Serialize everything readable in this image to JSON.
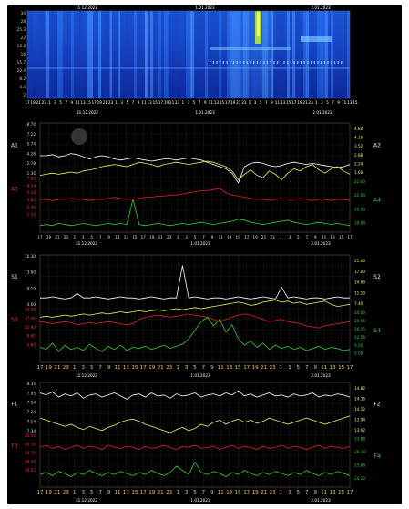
{
  "chart_data": [
    {
      "id": "spectrogram",
      "type": "heatmap",
      "top_labels": [
        "31.12.2022",
        "1.01.2023",
        "2.01.2023"
      ],
      "date_labels": [
        "31.12.2022",
        "1.01.2023",
        "2.01.2023"
      ],
      "y_ticks": [
        "34",
        "28",
        "25.3",
        "22",
        "18.8",
        "16",
        "15.7",
        "10.4",
        "8.2",
        "4.4",
        "2"
      ],
      "colors": {
        "low": "#0b1f8f",
        "mid": "#1f5fe0",
        "high": "#b8f23a",
        "peak": "#f0ff60"
      }
    },
    {
      "id": "panel-A",
      "type": "line",
      "x_ticks": [
        "17",
        "19",
        "21",
        "23",
        "1",
        "3",
        "5",
        "7",
        "9",
        "11",
        "13",
        "15",
        "17",
        "19",
        "21",
        "23",
        "1",
        "3",
        "5",
        "7",
        "9",
        "11",
        "13",
        "15",
        "17",
        "19",
        "21",
        "23",
        "1",
        "3",
        "5",
        "7",
        "9",
        "11",
        "13",
        "15",
        "17"
      ],
      "date_labels": [
        "31.12.2022",
        "1.01.2023",
        "2.01.2023"
      ],
      "left_axis_labels": [
        "A1",
        "A3"
      ],
      "right_axis_labels": [
        "A2",
        "A4"
      ],
      "left_ticks_upper": [
        "8.70",
        "7.22",
        "5.74",
        "4.26",
        "2.78",
        "1.30"
      ],
      "left_ticks_lower": [
        "7.90",
        "6.54",
        "5.18",
        "3.82",
        "2.46",
        "1.10"
      ],
      "right_ticks_upper": [
        "4.80",
        "4.16",
        "3.52",
        "2.88",
        "2.24",
        "1.60"
      ],
      "right_ticks_lower": [
        "22.00",
        "21.00",
        "20.00",
        "19.00"
      ],
      "series": [
        {
          "color": "#ffffff",
          "values": [
            0.3,
            0.3,
            0.29,
            0.31,
            0.3,
            0.28,
            0.29,
            0.31,
            0.33,
            0.31,
            0.3,
            0.31,
            0.33,
            0.34,
            0.33,
            0.32,
            0.33,
            0.34,
            0.35,
            0.34,
            0.33,
            0.33,
            0.34,
            0.33,
            0.32,
            0.33,
            0.34,
            0.36,
            0.38,
            0.4,
            0.42,
            0.46,
            0.55,
            0.4,
            0.37,
            0.36,
            0.37,
            0.39,
            0.4,
            0.39,
            0.37,
            0.36,
            0.37,
            0.38,
            0.37,
            0.38,
            0.39,
            0.4,
            0.41,
            0.4,
            0.38
          ]
        },
        {
          "color": "#f2f25a",
          "values": [
            0.48,
            0.47,
            0.46,
            0.47,
            0.46,
            0.45,
            0.46,
            0.44,
            0.43,
            0.42,
            0.4,
            0.39,
            0.38,
            0.39,
            0.4,
            0.38,
            0.36,
            0.37,
            0.38,
            0.4,
            0.38,
            0.37,
            0.36,
            0.37,
            0.38,
            0.37,
            0.36,
            0.35,
            0.36,
            0.38,
            0.4,
            0.44,
            0.52,
            0.47,
            0.43,
            0.48,
            0.5,
            0.44,
            0.47,
            0.52,
            0.46,
            0.42,
            0.44,
            0.4,
            0.38,
            0.43,
            0.46,
            0.42,
            0.4,
            0.44,
            0.47
          ]
        },
        {
          "color": "#e02020",
          "values": [
            0.7,
            0.7,
            0.71,
            0.7,
            0.7,
            0.69,
            0.7,
            0.7,
            0.71,
            0.7,
            0.7,
            0.69,
            0.68,
            0.69,
            0.7,
            0.7,
            0.69,
            0.68,
            0.68,
            0.67,
            0.67,
            0.66,
            0.66,
            0.65,
            0.64,
            0.63,
            0.62,
            0.62,
            0.61,
            0.6,
            0.64,
            0.66,
            0.67,
            0.68,
            0.69,
            0.7,
            0.7,
            0.71,
            0.7,
            0.69,
            0.7,
            0.7,
            0.69,
            0.7,
            0.71,
            0.7,
            0.7,
            0.71,
            0.7,
            0.7,
            0.71
          ]
        },
        {
          "color": "#2fd12f",
          "values": [
            0.94,
            0.93,
            0.94,
            0.92,
            0.93,
            0.94,
            0.93,
            0.92,
            0.93,
            0.94,
            0.93,
            0.92,
            0.93,
            0.92,
            0.93,
            0.7,
            0.93,
            0.94,
            0.93,
            0.92,
            0.93,
            0.94,
            0.93,
            0.92,
            0.93,
            0.92,
            0.91,
            0.92,
            0.93,
            0.92,
            0.91,
            0.9,
            0.88,
            0.89,
            0.91,
            0.92,
            0.93,
            0.92,
            0.91,
            0.9,
            0.89,
            0.91,
            0.92,
            0.93,
            0.92,
            0.91,
            0.92,
            0.93,
            0.92,
            0.93,
            0.94
          ]
        }
      ]
    },
    {
      "id": "panel-S",
      "type": "line",
      "x_ticks": [
        "17",
        "19",
        "21",
        "23",
        "1",
        "3",
        "5",
        "7",
        "9",
        "11",
        "13",
        "15",
        "17",
        "19",
        "21",
        "23",
        "1",
        "3",
        "5",
        "7",
        "9",
        "11",
        "13",
        "15",
        "17",
        "19",
        "21",
        "23",
        "1",
        "3",
        "5",
        "7",
        "9",
        "11",
        "13",
        "15",
        "17"
      ],
      "date_labels": [
        "31.12.2022",
        "1.01.2023",
        "2.01.2023"
      ],
      "left_axis_labels": [
        "S1",
        "S3"
      ],
      "right_axis_labels": [
        "S2",
        "S4"
      ],
      "left_ticks_upper": [
        "10.30",
        "13.60",
        "9.10",
        "4.60"
      ],
      "left_ticks_lower": [
        "20.50",
        "17.40",
        "11.90",
        "8.40",
        "5.65"
      ],
      "right_ticks_upper": [
        "21.00",
        "17.60",
        "14.60",
        "11.10",
        "7.40"
      ],
      "right_ticks_lower": [
        "24.00",
        "20.56",
        "16.45",
        "12.56",
        "9.20",
        "5.00"
      ],
      "series": [
        {
          "color": "#ffffff",
          "values": [
            0.4,
            0.4,
            0.39,
            0.4,
            0.41,
            0.4,
            0.36,
            0.4,
            0.4,
            0.39,
            0.4,
            0.41,
            0.4,
            0.39,
            0.4,
            0.4,
            0.41,
            0.4,
            0.39,
            0.4,
            0.41,
            0.4,
            0.4,
            0.1,
            0.4,
            0.39,
            0.4,
            0.41,
            0.4,
            0.4,
            0.41,
            0.4,
            0.39,
            0.4,
            0.41,
            0.4,
            0.39,
            0.4,
            0.41,
            0.3,
            0.4,
            0.39,
            0.4,
            0.41,
            0.4,
            0.4,
            0.41,
            0.4,
            0.39,
            0.4,
            0.4
          ]
        },
        {
          "color": "#f2f25a",
          "values": [
            0.58,
            0.57,
            0.58,
            0.57,
            0.56,
            0.57,
            0.56,
            0.55,
            0.56,
            0.55,
            0.54,
            0.55,
            0.54,
            0.53,
            0.54,
            0.53,
            0.52,
            0.53,
            0.52,
            0.51,
            0.52,
            0.51,
            0.5,
            0.51,
            0.5,
            0.49,
            0.5,
            0.49,
            0.48,
            0.47,
            0.46,
            0.45,
            0.44,
            0.45,
            0.47,
            0.46,
            0.44,
            0.43,
            0.42,
            0.44,
            0.43,
            0.45,
            0.44,
            0.46,
            0.45,
            0.44,
            0.43,
            0.46,
            0.48,
            0.47,
            0.46
          ]
        },
        {
          "color": "#e02020",
          "values": [
            0.62,
            0.63,
            0.64,
            0.63,
            0.62,
            0.63,
            0.65,
            0.64,
            0.63,
            0.64,
            0.63,
            0.62,
            0.63,
            0.64,
            0.65,
            0.64,
            0.6,
            0.58,
            0.57,
            0.56,
            0.57,
            0.58,
            0.57,
            0.56,
            0.55,
            0.56,
            0.57,
            0.58,
            0.6,
            0.62,
            0.6,
            0.58,
            0.56,
            0.55,
            0.56,
            0.58,
            0.6,
            0.62,
            0.61,
            0.6,
            0.62,
            0.63,
            0.64,
            0.66,
            0.67,
            0.68,
            0.66,
            0.65,
            0.64,
            0.63,
            0.62
          ]
        },
        {
          "color": "#2fd12f",
          "values": [
            0.86,
            0.88,
            0.82,
            0.9,
            0.84,
            0.88,
            0.86,
            0.89,
            0.83,
            0.87,
            0.9,
            0.85,
            0.88,
            0.84,
            0.89,
            0.86,
            0.87,
            0.85,
            0.88,
            0.86,
            0.84,
            0.87,
            0.85,
            0.83,
            0.78,
            0.7,
            0.62,
            0.58,
            0.66,
            0.6,
            0.72,
            0.65,
            0.78,
            0.84,
            0.8,
            0.86,
            0.82,
            0.88,
            0.84,
            0.87,
            0.85,
            0.88,
            0.86,
            0.89,
            0.87,
            0.85,
            0.88,
            0.86,
            0.87,
            0.89,
            0.88
          ]
        }
      ]
    },
    {
      "id": "panel-F",
      "type": "line",
      "x_ticks": [
        "17",
        "19",
        "21",
        "23",
        "1",
        "3",
        "5",
        "7",
        "9",
        "11",
        "13",
        "15",
        "17",
        "19",
        "21",
        "23",
        "1",
        "3",
        "5",
        "7",
        "9",
        "11",
        "13",
        "15",
        "17",
        "19",
        "21",
        "23",
        "1",
        "3",
        "5",
        "7",
        "9",
        "11",
        "13",
        "15",
        "17"
      ],
      "date_labels": [
        "31.12.2022",
        "1.01.2023",
        "2.01.2023"
      ],
      "left_axis_labels": [
        "F1",
        "F3"
      ],
      "right_axis_labels": [
        "F2",
        "F4"
      ],
      "left_ticks_upper": [
        "8.35",
        "7.95",
        "7.54",
        "7.24",
        "7.14",
        "7.34"
      ],
      "left_ticks_lower": [
        "20.50",
        "20.10",
        "19.70",
        "19.42",
        "19.02"
      ],
      "right_ticks_upper": [
        "14.82",
        "14.36",
        "14.12",
        "13.94",
        "13.62"
      ],
      "right_ticks_lower": [
        "13.88",
        "26.38",
        "25.88",
        "24.10"
      ],
      "series": [
        {
          "color": "#ffffff",
          "values": [
            0.1,
            0.12,
            0.09,
            0.14,
            0.11,
            0.13,
            0.1,
            0.15,
            0.12,
            0.11,
            0.14,
            0.12,
            0.1,
            0.13,
            0.16,
            0.12,
            0.11,
            0.14,
            0.1,
            0.13,
            0.12,
            0.15,
            0.11,
            0.13,
            0.12,
            0.1,
            0.14,
            0.12,
            0.11,
            0.13,
            0.1,
            0.12,
            0.08,
            0.13,
            0.11,
            0.14,
            0.12,
            0.1,
            0.13,
            0.12,
            0.14,
            0.11,
            0.13,
            0.12,
            0.1,
            0.14,
            0.12,
            0.13,
            0.11,
            0.12,
            0.14
          ]
        },
        {
          "color": "#f2f25a",
          "values": [
            0.34,
            0.36,
            0.38,
            0.4,
            0.42,
            0.4,
            0.43,
            0.45,
            0.42,
            0.44,
            0.46,
            0.43,
            0.41,
            0.38,
            0.36,
            0.35,
            0.37,
            0.4,
            0.42,
            0.44,
            0.46,
            0.48,
            0.45,
            0.43,
            0.46,
            0.44,
            0.4,
            0.42,
            0.38,
            0.36,
            0.4,
            0.37,
            0.35,
            0.38,
            0.36,
            0.39,
            0.37,
            0.34,
            0.36,
            0.38,
            0.4,
            0.38,
            0.36,
            0.34,
            0.36,
            0.38,
            0.4,
            0.38,
            0.36,
            0.34,
            0.32
          ]
        },
        {
          "color": "#e02020",
          "values": [
            0.62,
            0.6,
            0.63,
            0.61,
            0.64,
            0.62,
            0.6,
            0.63,
            0.61,
            0.62,
            0.64,
            0.6,
            0.62,
            0.63,
            0.61,
            0.62,
            0.64,
            0.61,
            0.63,
            0.62,
            0.6,
            0.62,
            0.64,
            0.61,
            0.62,
            0.6,
            0.63,
            0.62,
            0.61,
            0.64,
            0.62,
            0.6,
            0.63,
            0.61,
            0.62,
            0.64,
            0.61,
            0.63,
            0.62,
            0.6,
            0.63,
            0.61,
            0.62,
            0.64,
            0.62,
            0.6,
            0.63,
            0.61,
            0.62,
            0.63,
            0.61
          ]
        },
        {
          "color": "#2fd12f",
          "values": [
            0.88,
            0.86,
            0.89,
            0.85,
            0.87,
            0.9,
            0.86,
            0.88,
            0.84,
            0.87,
            0.89,
            0.86,
            0.88,
            0.85,
            0.87,
            0.89,
            0.86,
            0.88,
            0.84,
            0.87,
            0.89,
            0.86,
            0.8,
            0.84,
            0.88,
            0.76,
            0.86,
            0.88,
            0.85,
            0.87,
            0.9,
            0.86,
            0.88,
            0.84,
            0.87,
            0.89,
            0.86,
            0.88,
            0.85,
            0.87,
            0.89,
            0.86,
            0.88,
            0.84,
            0.87,
            0.89,
            0.86,
            0.88,
            0.85,
            0.87,
            0.89
          ]
        }
      ]
    }
  ]
}
